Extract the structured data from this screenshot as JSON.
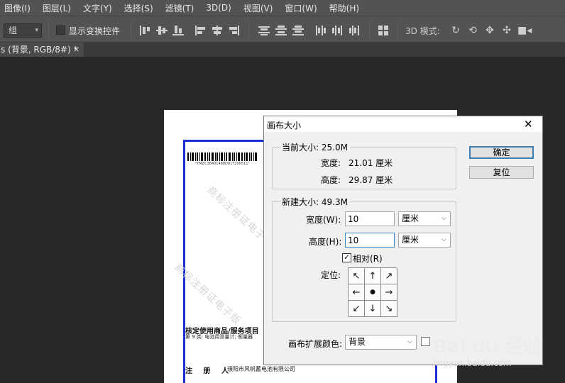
{
  "menu": {
    "items": [
      "图像(I)",
      "图层(L)",
      "文字(Y)",
      "选择(S)",
      "滤镜(T)",
      "3D(D)",
      "视图(V)",
      "窗口(W)",
      "帮助(H)"
    ]
  },
  "options_bar": {
    "select_value": "组",
    "show_transform_label": "显示变换控件",
    "show_transform_checked": false,
    "mode_3d_label": "3D 模式:",
    "icons": [
      "rotate-3d-icon",
      "roll-3d-icon",
      "drag-3d-icon",
      "slide-3d-icon",
      "video-camera-icon"
    ]
  },
  "tab": {
    "title": "s (背景, RGB/8#) *",
    "close": "×"
  },
  "document": {
    "barcode_text": "\"TMZC38401468D01T200511\"",
    "watermark_1": "商标注册证电子",
    "watermark_2": "商标注册证电子版",
    "heading": "核定使用商品/服务项目",
    "class_line": "第 9 类: 电池用测量计; 衡量器",
    "registrant_label": "注 册 人",
    "registrant_value": "濮阳市风帆蓄电池有限公司"
  },
  "dialog": {
    "title": "画布大小",
    "close": "✕",
    "current": {
      "legend": "当前大小: 25.0M",
      "width_label": "宽度:",
      "width_value": "21.01 厘米",
      "height_label": "高度:",
      "height_value": "29.87 厘米"
    },
    "new": {
      "legend": "新建大小: 49.3M",
      "width_label": "宽度(W):",
      "width_value": "10",
      "width_unit": "厘米",
      "height_label": "高度(H):",
      "height_value": "10",
      "height_unit": "厘米",
      "relative_label": "相对(R)",
      "relative_checked": true,
      "anchor_label": "定位:",
      "anchor_arrows": [
        "↖",
        "↑",
        "↗",
        "←",
        "●",
        "→",
        "↙",
        "↓",
        "↘"
      ]
    },
    "extension_color_label": "画布扩展颜色:",
    "extension_color_value": "背景",
    "ok_label": "确定",
    "reset_label": "复位"
  },
  "watermark": {
    "brand": "Bai du 经验",
    "url": "jingyan.baidu.com"
  }
}
